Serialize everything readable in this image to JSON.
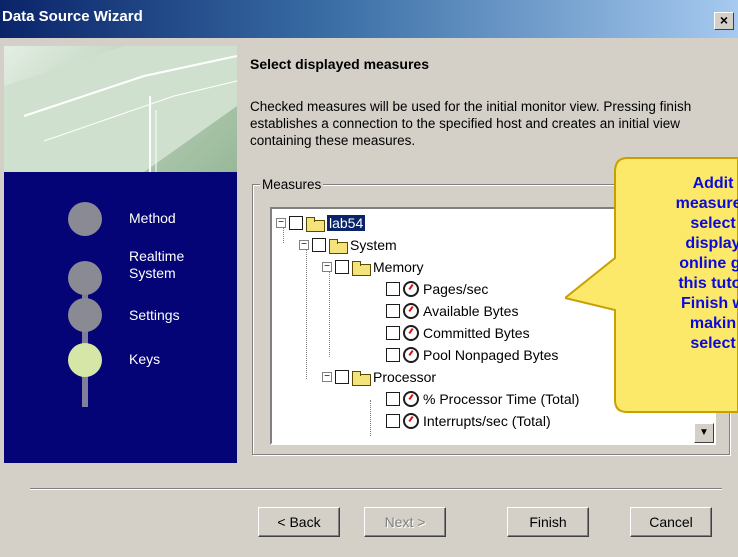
{
  "window": {
    "title": "Data Source Wizard",
    "close_label": "×"
  },
  "steps": [
    {
      "label": "Method"
    },
    {
      "label": "Realtime\nSystem"
    },
    {
      "label": "Settings"
    },
    {
      "label": "Keys"
    }
  ],
  "page": {
    "heading": "Select displayed measures",
    "description": "Checked measures will be used for the initial monitor view. Pressing finish establishes a connection to the specified host and creates an initial view containing these measures.",
    "group_label": "Measures"
  },
  "tree": [
    {
      "label": "lab54",
      "type": "folder",
      "expander": "−",
      "selected": true
    },
    {
      "label": "System",
      "type": "folder",
      "expander": "−"
    },
    {
      "label": "Memory",
      "type": "folder",
      "expander": "−"
    },
    {
      "label": "Pages/sec",
      "type": "counter"
    },
    {
      "label": "Available Bytes",
      "type": "counter"
    },
    {
      "label": "Committed Bytes",
      "type": "counter"
    },
    {
      "label": "Pool Nonpaged Bytes",
      "type": "counter"
    },
    {
      "label": "Processor",
      "type": "folder",
      "expander": "−"
    },
    {
      "label": "% Processor Time (Total)",
      "type": "counter"
    },
    {
      "label": "Interrupts/sec (Total)",
      "type": "counter"
    }
  ],
  "scroll_down_label": "▼",
  "callout": {
    "text": "Addit\nmeasures\nselect\ndisplay\nonline gr\nthis tutor\nFinish w\nmakin\nselect",
    "fill": "#fce96a",
    "border": "#c8a000",
    "text_color": "#0a0adc"
  },
  "buttons": {
    "back": "< Back",
    "next": "Next >",
    "finish": "Finish",
    "cancel": "Cancel"
  }
}
